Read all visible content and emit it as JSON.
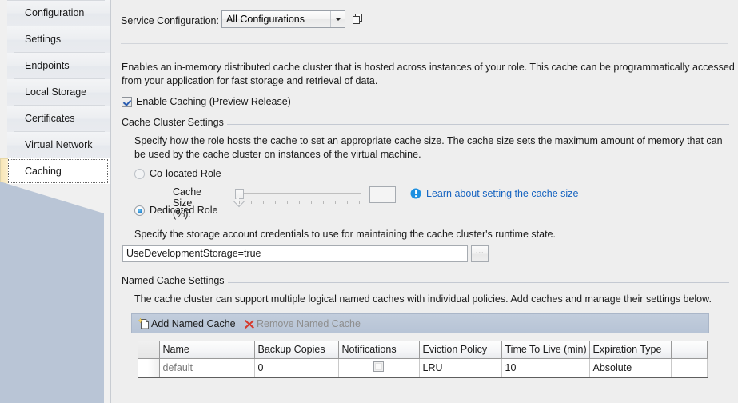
{
  "sidebar": {
    "items": [
      {
        "label": "Configuration",
        "selected": false
      },
      {
        "label": "Settings",
        "selected": false
      },
      {
        "label": "Endpoints",
        "selected": false
      },
      {
        "label": "Local Storage",
        "selected": false
      },
      {
        "label": "Certificates",
        "selected": false
      },
      {
        "label": "Virtual Network",
        "selected": false
      },
      {
        "label": "Caching",
        "selected": true
      }
    ]
  },
  "toolbar": {
    "service_configuration_label": "Service Configuration:",
    "service_configuration_value": "All Configurations",
    "copy_icon": "copy-configuration-icon"
  },
  "description": "Enables an in-memory distributed cache cluster that is hosted across instances of your role. This cache can be programmatically accessed from your application for fast storage and retrieval of data.",
  "enable_caching": {
    "label": "Enable Caching (Preview Release)",
    "checked": true
  },
  "cache_cluster": {
    "group_title": "Cache Cluster Settings",
    "description": "Specify how the role hosts the cache to set an appropriate cache size. The cache size sets the maximum amount of memory that can be used by the cache cluster on instances of the virtual machine.",
    "co_located_label": "Co-located Role",
    "co_located_selected": false,
    "dedicated_label": "Dedicated Role",
    "dedicated_selected": true,
    "cache_size_label": "Cache Size (%):",
    "cache_size_value": "",
    "cache_size_enabled": false,
    "learn_link": "Learn about setting the cache size",
    "info_icon": "info-circle-icon",
    "storage_description": "Specify the storage account credentials to use for maintaining the cache cluster's runtime state.",
    "storage_value": "UseDevelopmentStorage=true",
    "browse_button": "...",
    "link_color": "#1764c0"
  },
  "named_cache": {
    "group_title": "Named Cache Settings",
    "description": "The cache cluster can support multiple logical named caches with individual policies. Add caches and manage their settings below.",
    "add_button": "Add Named Cache",
    "add_icon": "new-page-icon",
    "remove_button": "Remove Named Cache",
    "remove_icon": "red-x-icon",
    "remove_disabled": true,
    "columns": [
      "Name",
      "Backup Copies",
      "Notifications",
      "Eviction Policy",
      "Time To Live (min)",
      "Expiration Type"
    ],
    "rows": [
      {
        "name": "default",
        "backup_copies": "0",
        "notifications_checked": false,
        "eviction_policy": "LRU",
        "time_to_live": "10",
        "expiration_type": "Absolute"
      }
    ]
  }
}
